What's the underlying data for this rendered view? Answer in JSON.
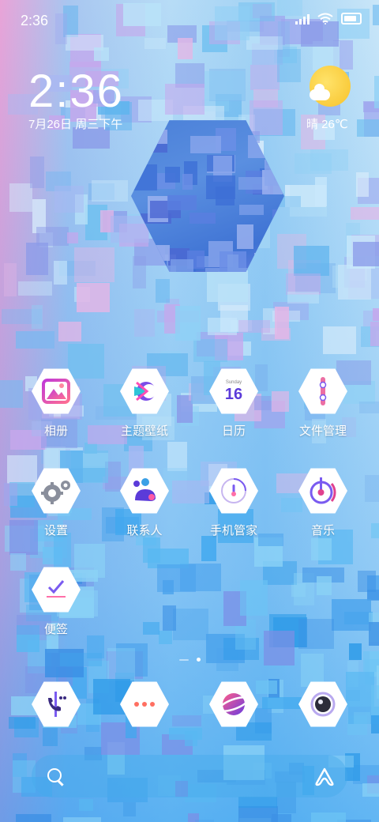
{
  "status_bar": {
    "time": "2:36"
  },
  "clock_widget": {
    "time": "2:36",
    "date": "7月26日 周三下午",
    "weather": "晴 26℃"
  },
  "apps": [
    {
      "label": "相册",
      "icon": "gallery-icon"
    },
    {
      "label": "主题壁纸",
      "icon": "themes-icon"
    },
    {
      "label": "日历",
      "icon": "calendar-icon",
      "calendar_day": "Sunday",
      "calendar_date": "16"
    },
    {
      "label": "文件管理",
      "icon": "file-manager-icon"
    },
    {
      "label": "设置",
      "icon": "settings-icon"
    },
    {
      "label": "联系人",
      "icon": "contacts-icon"
    },
    {
      "label": "手机管家",
      "icon": "security-icon"
    },
    {
      "label": "音乐",
      "icon": "music-icon"
    },
    {
      "label": "便签",
      "icon": "notes-icon"
    }
  ],
  "dock": [
    {
      "icon": "phone-icon"
    },
    {
      "icon": "messages-icon"
    },
    {
      "icon": "browser-icon"
    },
    {
      "icon": "camera-icon"
    }
  ],
  "search": {
    "icon": "search-icon",
    "assistant_icon": "assistant-icon"
  },
  "colors": {
    "accent_purple": "#7c3aed",
    "accent_pink": "#e0418f",
    "sun": "#f7c22a"
  }
}
